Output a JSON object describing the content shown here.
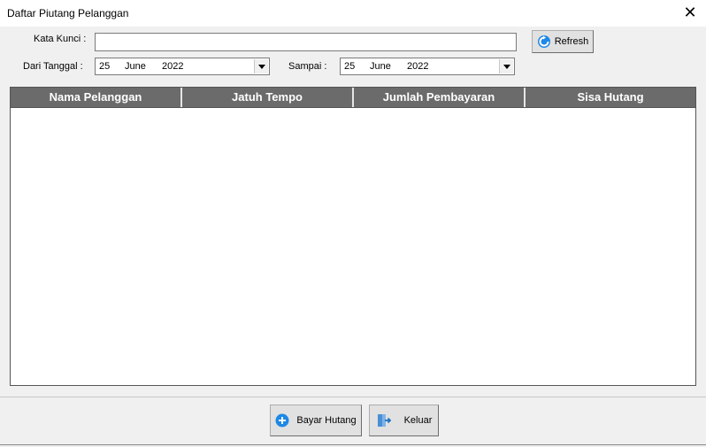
{
  "window": {
    "title": "Daftar Piutang Pelanggan",
    "close_icon": "close-icon"
  },
  "filters": {
    "keyword_label": "Kata Kunci :",
    "keyword_value": "",
    "refresh_label": "Refresh",
    "from_label": "Dari Tanggal :",
    "from_date": {
      "day": "25",
      "month": "June",
      "year": "2022"
    },
    "to_label": "Sampai :",
    "to_date": {
      "day": "25",
      "month": "June",
      "year": "2022"
    }
  },
  "table": {
    "columns": [
      "Nama Pelanggan",
      "Jatuh Tempo",
      "Jumlah Pembayaran",
      "Sisa Hutang"
    ],
    "rows": []
  },
  "footer": {
    "pay_label": "Bayar Hutang",
    "exit_label": "Keluar"
  }
}
